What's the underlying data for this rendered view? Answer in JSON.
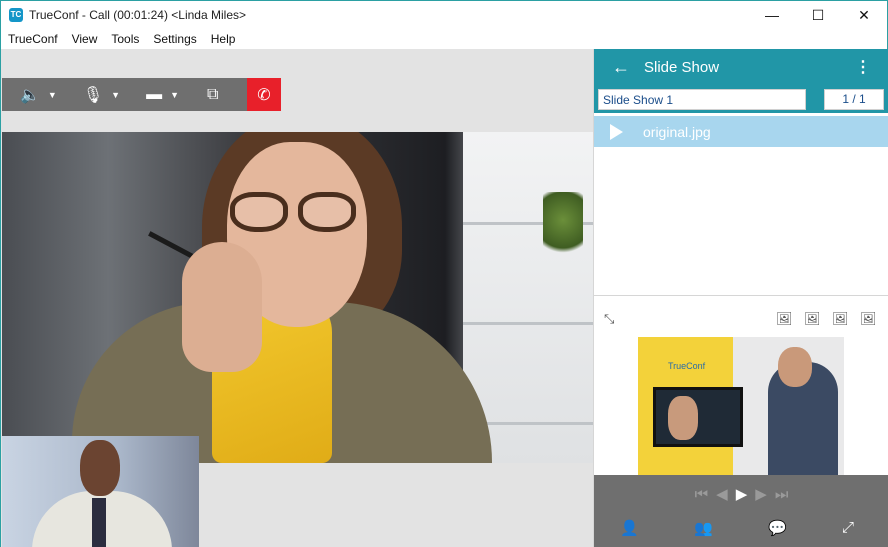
{
  "window": {
    "title": "TrueConf - Call (00:01:24) <Linda Miles>",
    "app_icon": "trueconf-logo-icon",
    "minimize_icon": "—",
    "maximize_icon": "☐",
    "close_icon": "✕"
  },
  "menu": {
    "items": [
      "TrueConf",
      "View",
      "Tools",
      "Settings",
      "Help"
    ]
  },
  "call_toolbar": {
    "speaker_icon": "🔈",
    "mic_icon": "🎙",
    "camera_icon": "▬",
    "share_icon": "⧉",
    "hangup_icon": "✆",
    "caret": "▼",
    "hangup_color": "#e8202a"
  },
  "slide_show": {
    "header_title": "Slide Show",
    "back_icon": "←",
    "more_icon": "⋮",
    "name": "Slide Show 1",
    "page_indicator": "1 / 1",
    "items": [
      {
        "label": "original.jpg",
        "playing": true
      }
    ],
    "accent_color": "#2196a7",
    "selected_color": "#a8d6ee"
  },
  "preview_tools": {
    "fit_icon": "⤡",
    "add_image_icon": "🖼",
    "remove_image_icon": "🖼",
    "move_up_icon": "🖼",
    "move_down_icon": "🖼",
    "tv_logo": "TrueConf"
  },
  "playback": {
    "first_icon": "⏮",
    "prev_icon": "◀",
    "play_icon": "▶",
    "next_icon": "▶",
    "last_icon": "⏭"
  },
  "bottom_bar": {
    "contacts_icon": "👤",
    "participants_icon": "👥",
    "chat_icon": "💬",
    "expand_icon": "⤢"
  }
}
